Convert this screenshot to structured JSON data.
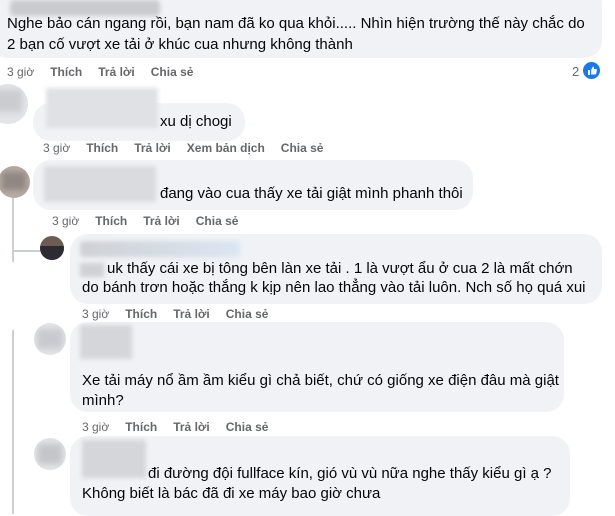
{
  "comments": [
    {
      "text_lines": [
        "Nghe bảo cán ngang rồi, bạn nam đã ko qua khỏi..... Nhìn hiện trường thế này chắc do",
        "2 bạn cố vượt xe tải ở khúc cua nhưng không thành"
      ],
      "actions": [
        "3 giờ",
        "Thích",
        "Trả lời",
        "Chia sẻ"
      ],
      "reaction_count": "2"
    },
    {
      "text_lines": [
        "xu dị chogi"
      ],
      "actions": [
        "3 giờ",
        "Thích",
        "Trả lời",
        "Xem bản dịch",
        "Chia sẻ"
      ]
    },
    {
      "text_lines": [
        "đang vào cua thấy xe tải giật mình phanh thôi"
      ],
      "actions": [
        "3 giờ",
        "Thích",
        "Trả lời",
        "Chia sẻ"
      ]
    },
    {
      "text_lines": [
        "uk thấy cái xe bị tông bên làn xe tải . 1 là vượt ẩu ở cua 2 là mất chớn",
        "do bánh trơn hoặc thắng k kịp nên lao thẳng vào tải luôn. Nch số họ quá xui"
      ],
      "actions": [
        "3 giờ",
        "Thích",
        "Trả lời",
        "Chia sẻ"
      ]
    },
    {
      "text_lines": [
        "Xe tải máy nổ ầm ầm kiểu gì chả biết, chứ có giống xe điện đâu mà giật",
        "mình?"
      ],
      "actions": [
        "3 giờ",
        "Thích",
        "Trả lời",
        "Chia sẻ"
      ]
    },
    {
      "text_lines": [
        "đi đường đội fullface kín, gió vù vù nữa nghe thấy kiểu gì ạ ?",
        "Không biết là bác đã đi xe máy bao giờ chưa"
      ]
    }
  ],
  "colors": {
    "bubble": "#f0f2f5",
    "meta": "#65676b",
    "like_badge": "#1877f2"
  },
  "icons": [
    "like-icon"
  ]
}
